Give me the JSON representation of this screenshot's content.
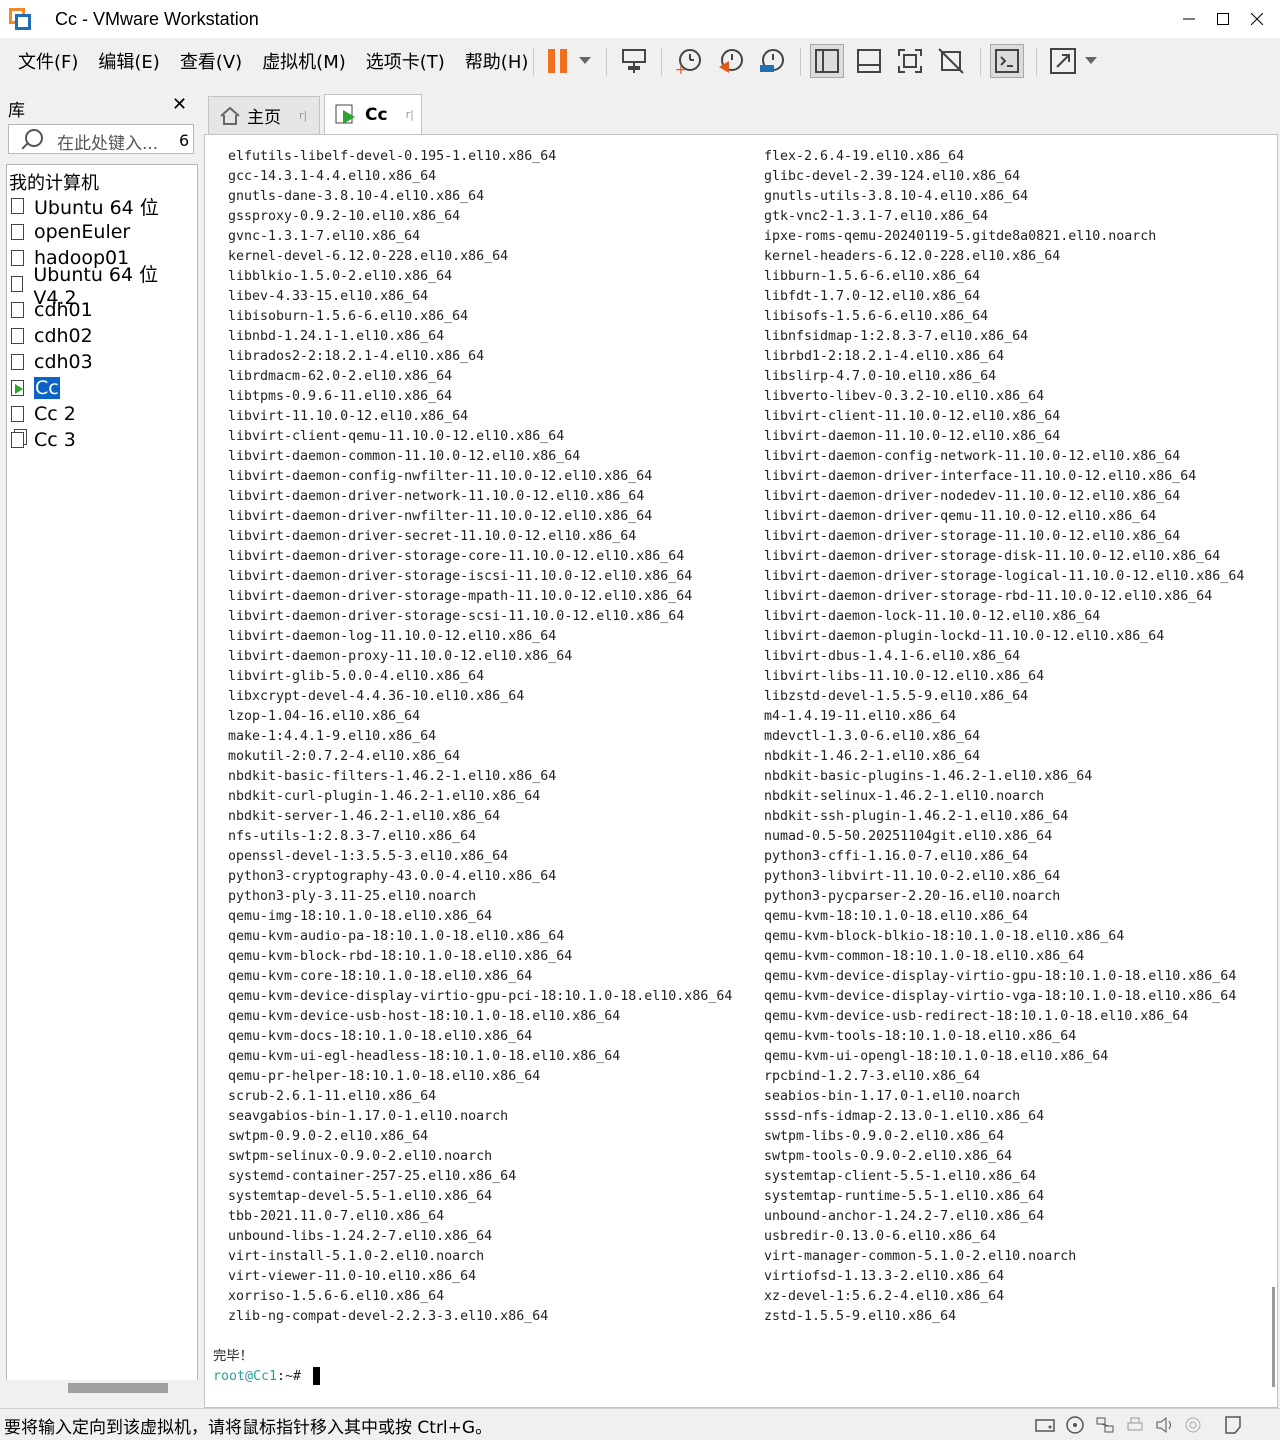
{
  "window": {
    "title": "Cc - VMware Workstation"
  },
  "menu": [
    "文件(F)",
    "编辑(E)",
    "查看(V)",
    "虚拟机(M)",
    "选项卡(T)",
    "帮助(H)"
  ],
  "library": {
    "title": "库",
    "search_placeholder": "在此处键入...",
    "search_count": "6",
    "root": "我的计算机",
    "items": [
      "Ubuntu 64 位",
      "openEuler",
      "hadoop01",
      "Ubuntu 64 位 V4.2",
      "cdh01",
      "cdh02",
      "cdh03",
      "Cc",
      "Cc 2",
      "Cc 3"
    ]
  },
  "tabs": [
    {
      "label": "主页"
    },
    {
      "label": "Cc"
    }
  ],
  "console": {
    "left": [
      "elfutils-libelf-devel-0.195-1.el10.x86_64",
      "gcc-14.3.1-4.4.el10.x86_64",
      "gnutls-dane-3.8.10-4.el10.x86_64",
      "gssproxy-0.9.2-10.el10.x86_64",
      "gvnc-1.3.1-7.el10.x86_64",
      "kernel-devel-6.12.0-228.el10.x86_64",
      "libblkio-1.5.0-2.el10.x86_64",
      "libev-4.33-15.el10.x86_64",
      "libisoburn-1.5.6-6.el10.x86_64",
      "libnbd-1.24.1-1.el10.x86_64",
      "librados2-2:18.2.1-4.el10.x86_64",
      "librdmacm-62.0-2.el10.x86_64",
      "libtpms-0.9.6-11.el10.x86_64",
      "libvirt-11.10.0-12.el10.x86_64",
      "libvirt-client-qemu-11.10.0-12.el10.x86_64",
      "libvirt-daemon-common-11.10.0-12.el10.x86_64",
      "libvirt-daemon-config-nwfilter-11.10.0-12.el10.x86_64",
      "libvirt-daemon-driver-network-11.10.0-12.el10.x86_64",
      "libvirt-daemon-driver-nwfilter-11.10.0-12.el10.x86_64",
      "libvirt-daemon-driver-secret-11.10.0-12.el10.x86_64",
      "libvirt-daemon-driver-storage-core-11.10.0-12.el10.x86_64",
      "libvirt-daemon-driver-storage-iscsi-11.10.0-12.el10.x86_64",
      "libvirt-daemon-driver-storage-mpath-11.10.0-12.el10.x86_64",
      "libvirt-daemon-driver-storage-scsi-11.10.0-12.el10.x86_64",
      "libvirt-daemon-log-11.10.0-12.el10.x86_64",
      "libvirt-daemon-proxy-11.10.0-12.el10.x86_64",
      "libvirt-glib-5.0.0-4.el10.x86_64",
      "libxcrypt-devel-4.4.36-10.el10.x86_64",
      "lzop-1.04-16.el10.x86_64",
      "make-1:4.4.1-9.el10.x86_64",
      "mokutil-2:0.7.2-4.el10.x86_64",
      "nbdkit-basic-filters-1.46.2-1.el10.x86_64",
      "nbdkit-curl-plugin-1.46.2-1.el10.x86_64",
      "nbdkit-server-1.46.2-1.el10.x86_64",
      "nfs-utils-1:2.8.3-7.el10.x86_64",
      "openssl-devel-1:3.5.5-3.el10.x86_64",
      "python3-cryptography-43.0.0-4.el10.x86_64",
      "python3-ply-3.11-25.el10.noarch",
      "qemu-img-18:10.1.0-18.el10.x86_64",
      "qemu-kvm-audio-pa-18:10.1.0-18.el10.x86_64",
      "qemu-kvm-block-rbd-18:10.1.0-18.el10.x86_64",
      "qemu-kvm-core-18:10.1.0-18.el10.x86_64",
      "qemu-kvm-device-display-virtio-gpu-pci-18:10.1.0-18.el10.x86_64",
      "qemu-kvm-device-usb-host-18:10.1.0-18.el10.x86_64",
      "qemu-kvm-docs-18:10.1.0-18.el10.x86_64",
      "qemu-kvm-ui-egl-headless-18:10.1.0-18.el10.x86_64",
      "qemu-pr-helper-18:10.1.0-18.el10.x86_64",
      "scrub-2.6.1-11.el10.x86_64",
      "seavgabios-bin-1.17.0-1.el10.noarch",
      "swtpm-0.9.0-2.el10.x86_64",
      "swtpm-selinux-0.9.0-2.el10.noarch",
      "systemd-container-257-25.el10.x86_64",
      "systemtap-devel-5.5-1.el10.x86_64",
      "tbb-2021.11.0-7.el10.x86_64",
      "unbound-libs-1.24.2-7.el10.x86_64",
      "virt-install-5.1.0-2.el10.noarch",
      "virt-viewer-11.0-10.el10.x86_64",
      "xorriso-1.5.6-6.el10.x86_64",
      "zlib-ng-compat-devel-2.2.3-3.el10.x86_64"
    ],
    "right": [
      "flex-2.6.4-19.el10.x86_64",
      "glibc-devel-2.39-124.el10.x86_64",
      "gnutls-utils-3.8.10-4.el10.x86_64",
      "gtk-vnc2-1.3.1-7.el10.x86_64",
      "ipxe-roms-qemu-20240119-5.gitde8a0821.el10.noarch",
      "kernel-headers-6.12.0-228.el10.x86_64",
      "libburn-1.5.6-6.el10.x86_64",
      "libfdt-1.7.0-12.el10.x86_64",
      "libisofs-1.5.6-6.el10.x86_64",
      "libnfsidmap-1:2.8.3-7.el10.x86_64",
      "librbd1-2:18.2.1-4.el10.x86_64",
      "libslirp-4.7.0-10.el10.x86_64",
      "libverto-libev-0.3.2-10.el10.x86_64",
      "libvirt-client-11.10.0-12.el10.x86_64",
      "libvirt-daemon-11.10.0-12.el10.x86_64",
      "libvirt-daemon-config-network-11.10.0-12.el10.x86_64",
      "libvirt-daemon-driver-interface-11.10.0-12.el10.x86_64",
      "libvirt-daemon-driver-nodedev-11.10.0-12.el10.x86_64",
      "libvirt-daemon-driver-qemu-11.10.0-12.el10.x86_64",
      "libvirt-daemon-driver-storage-11.10.0-12.el10.x86_64",
      "libvirt-daemon-driver-storage-disk-11.10.0-12.el10.x86_64",
      "libvirt-daemon-driver-storage-logical-11.10.0-12.el10.x86_64",
      "libvirt-daemon-driver-storage-rbd-11.10.0-12.el10.x86_64",
      "libvirt-daemon-lock-11.10.0-12.el10.x86_64",
      "libvirt-daemon-plugin-lockd-11.10.0-12.el10.x86_64",
      "libvirt-dbus-1.4.1-6.el10.x86_64",
      "libvirt-libs-11.10.0-12.el10.x86_64",
      "libzstd-devel-1.5.5-9.el10.x86_64",
      "m4-1.4.19-11.el10.x86_64",
      "mdevctl-1.3.0-6.el10.x86_64",
      "nbdkit-1.46.2-1.el10.x86_64",
      "nbdkit-basic-plugins-1.46.2-1.el10.x86_64",
      "nbdkit-selinux-1.46.2-1.el10.noarch",
      "nbdkit-ssh-plugin-1.46.2-1.el10.x86_64",
      "numad-0.5-50.20251104git.el10.x86_64",
      "python3-cffi-1.16.0-7.el10.x86_64",
      "python3-libvirt-11.10.0-2.el10.x86_64",
      "python3-pycparser-2.20-16.el10.noarch",
      "qemu-kvm-18:10.1.0-18.el10.x86_64",
      "qemu-kvm-block-blkio-18:10.1.0-18.el10.x86_64",
      "qemu-kvm-common-18:10.1.0-18.el10.x86_64",
      "qemu-kvm-device-display-virtio-gpu-18:10.1.0-18.el10.x86_64",
      "qemu-kvm-device-display-virtio-vga-18:10.1.0-18.el10.x86_64",
      "qemu-kvm-device-usb-redirect-18:10.1.0-18.el10.x86_64",
      "qemu-kvm-tools-18:10.1.0-18.el10.x86_64",
      "qemu-kvm-ui-opengl-18:10.1.0-18.el10.x86_64",
      "rpcbind-1.2.7-3.el10.x86_64",
      "seabios-bin-1.17.0-1.el10.noarch",
      "sssd-nfs-idmap-2.13.0-1.el10.x86_64",
      "swtpm-libs-0.9.0-2.el10.x86_64",
      "swtpm-tools-0.9.0-2.el10.x86_64",
      "systemtap-client-5.5-1.el10.x86_64",
      "systemtap-runtime-5.5-1.el10.x86_64",
      "unbound-anchor-1.24.2-7.el10.x86_64",
      "usbredir-0.13.0-6.el10.x86_64",
      "virt-manager-common-5.1.0-2.el10.noarch",
      "virtiofsd-1.13.3-2.el10.x86_64",
      "xz-devel-1:5.6.2-4.el10.x86_64",
      "zstd-1.5.5-9.el10.x86_64"
    ],
    "done": "完毕！",
    "prompt_user": "root@Cc1",
    "prompt_path": ":~# "
  },
  "statusbar": {
    "message": "要将输入定向到该虚拟机，请将鼠标指针移入其中或按 Ctrl+G。"
  },
  "colors": {
    "accent": "#0b63c5",
    "pause": "#f07020",
    "run": "#2ea32e"
  },
  "icons": [
    "vmware-logo-icon",
    "minimize-icon",
    "maximize-icon",
    "close-icon",
    "pause-icon",
    "dropdown-icon",
    "send-ctrl-alt-del-icon",
    "snapshot-take-icon",
    "snapshot-revert-icon",
    "snapshot-manager-icon",
    "library-view-icon",
    "thumbnail-view-icon",
    "fullscreen-icon",
    "unity-icon",
    "console-view-icon",
    "stretch-icon",
    "search-icon",
    "home-icon",
    "vm-running-icon",
    "hdd-icon",
    "cd-icon",
    "network-icon",
    "printer-icon",
    "sound-icon",
    "usb-icon",
    "message-icon"
  ]
}
